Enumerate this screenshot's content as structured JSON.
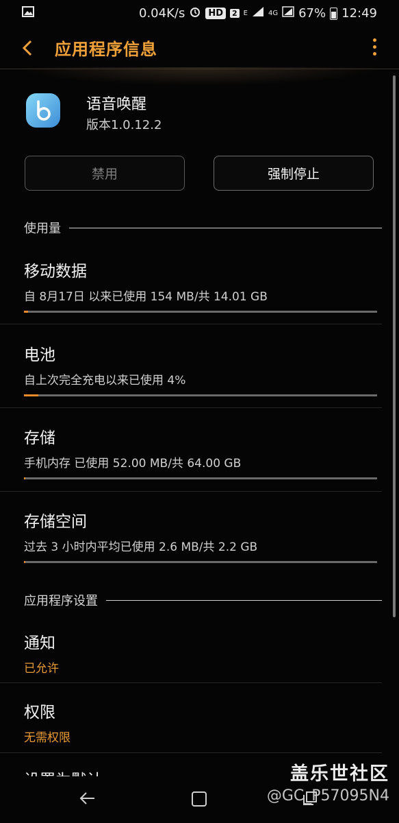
{
  "status_bar": {
    "net_speed": "0.04K/s",
    "hd_badge": "HD",
    "sim_badge": "2",
    "network_e": "E",
    "network_4g": "4G",
    "battery": "67%",
    "time": "12:49"
  },
  "app_bar": {
    "title": "应用程序信息"
  },
  "app": {
    "name": "语音唤醒",
    "version": "版本1.0.12.2"
  },
  "buttons": {
    "disable": "禁用",
    "force_stop": "强制停止"
  },
  "usage": {
    "header": "使用量",
    "items": [
      {
        "title": "移动数据",
        "subtitle": "自 8月17日 以来已使用 154 MB/共 14.01 GB",
        "progress": 0.011
      },
      {
        "title": "电池",
        "subtitle": "自上次完全充电以来已使用 4%",
        "progress": 0.04
      },
      {
        "title": "存储",
        "subtitle": "手机内存 已使用 52.00 MB/共 64.00 GB",
        "progress": 0.001
      },
      {
        "title": "存储空间",
        "subtitle": "过去 3 小时内平均已使用 2.6 MB/共 2.2 GB",
        "progress": 0.001
      }
    ]
  },
  "settings": {
    "header": "应用程序设置",
    "items": [
      {
        "title": "通知",
        "subtitle": "已允许"
      },
      {
        "title": "权限",
        "subtitle": "无需权限"
      }
    ],
    "partial_item": "设置为默认"
  },
  "watermark": {
    "site": "盖乐世社区",
    "user": "@GC_P57095N4"
  },
  "colors": {
    "accent": "#f0a13a",
    "background": "#050505",
    "progress": "#e98a2a"
  }
}
